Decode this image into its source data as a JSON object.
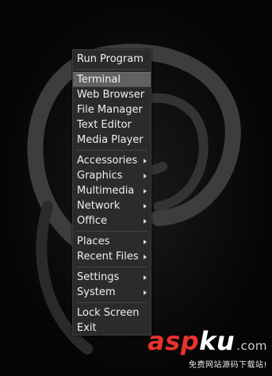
{
  "menu": {
    "run_program": "Run Program",
    "group_apps": [
      "Terminal",
      "Web Browser",
      "File Manager",
      "Text Editor",
      "Media Player"
    ],
    "group_categories": [
      "Accessories",
      "Graphics",
      "Multimedia",
      "Network",
      "Office"
    ],
    "group_places": [
      "Places",
      "Recent Files"
    ],
    "group_system": [
      "Settings",
      "System"
    ],
    "group_session": [
      "Lock Screen",
      "Exit"
    ],
    "active_item": "Terminal"
  },
  "watermark": {
    "brand_red": "asp",
    "brand_white": "ku",
    "tld": ".com",
    "tagline": "免费网站源码下载站!"
  },
  "colors": {
    "background": "#050505",
    "menu_bg": "#2b2b2b",
    "highlight": "#616161",
    "watermark_red": "#e8322b"
  }
}
